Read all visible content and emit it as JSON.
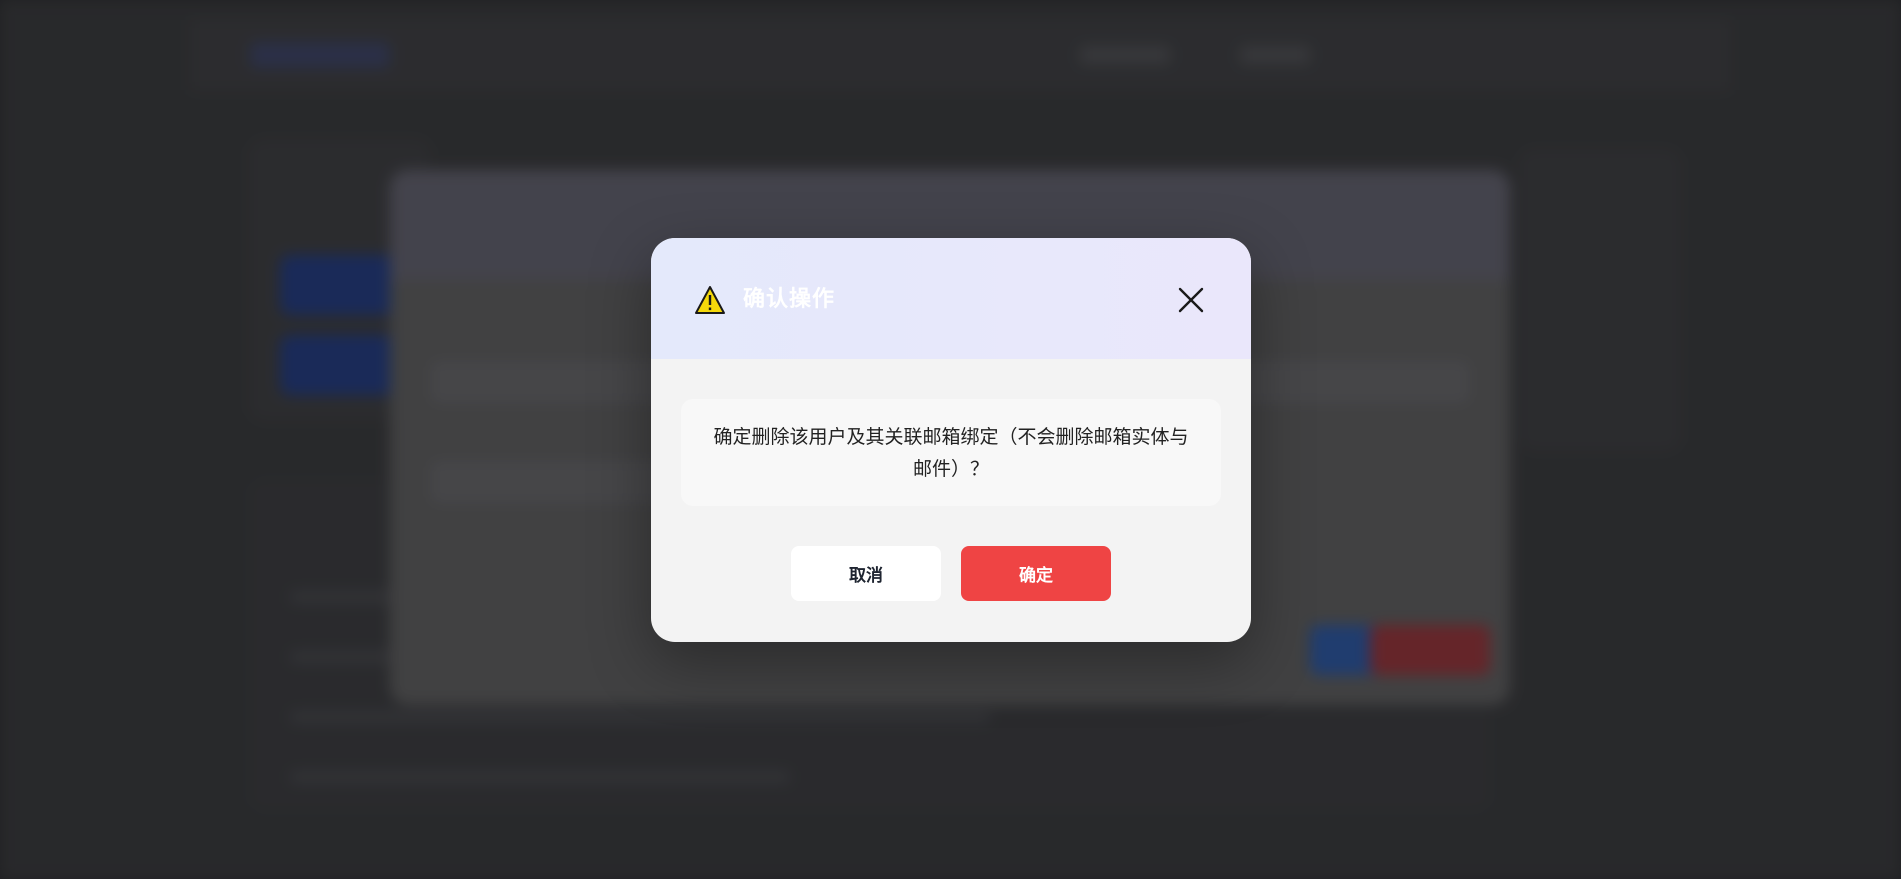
{
  "dialog": {
    "title": "确认操作",
    "icon": "warning-icon",
    "message": "确定删除该用户及其关联邮箱绑定（不会删除邮箱实体与邮件）？",
    "cancel_label": "取消",
    "confirm_label": "确定"
  },
  "colors": {
    "confirm_button": "#ef4444",
    "warning_fill": "#f5d90a",
    "header_gradient_start": "#e4e9fb",
    "header_gradient_end": "#eae7fb"
  }
}
